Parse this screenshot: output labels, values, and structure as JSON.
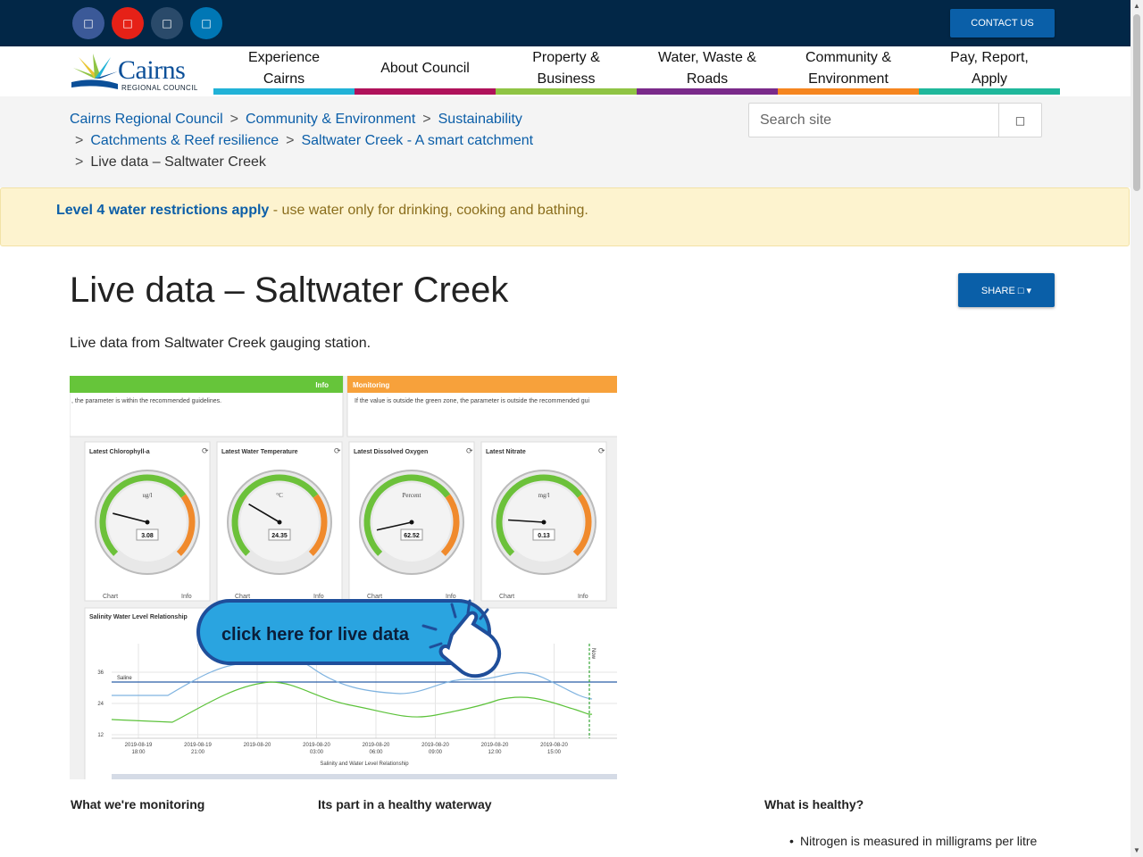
{
  "header": {
    "social": [
      {
        "name": "facebook-icon",
        "glyph": "□",
        "color": "#3b5998"
      },
      {
        "name": "youtube-icon",
        "glyph": "□",
        "color": "#e62117"
      },
      {
        "name": "instagram-icon",
        "glyph": "□",
        "color": "#2a4a6a"
      },
      {
        "name": "linkedin-icon",
        "glyph": "□",
        "color": "#0077b5"
      }
    ],
    "contact_label": "CONTACT US"
  },
  "logo": {
    "word": "Cairns",
    "sub": "REGIONAL COUNCIL"
  },
  "nav": [
    {
      "label": "Experience Cairns",
      "color": "#21b2d7"
    },
    {
      "label": "About Council",
      "color": "#b0125b"
    },
    {
      "label": "Property & Business",
      "color": "#8fc444"
    },
    {
      "label": "Water, Waste & Roads",
      "color": "#7a2a8a"
    },
    {
      "label": "Community & Environment",
      "color": "#f5851f"
    },
    {
      "label": "Pay, Report, Apply",
      "color": "#1fb79b"
    }
  ],
  "breadcrumb": {
    "items": [
      "Cairns Regional Council",
      "Community & Environment",
      "Sustainability",
      "Catchments & Reef resilience",
      "Saltwater Creek - A smart catchment"
    ],
    "current": "Live data – Saltwater Creek"
  },
  "search": {
    "placeholder": "Search site",
    "button_glyph": "□"
  },
  "alert": {
    "link": "Level 4 water restrictions apply",
    "text": " - use water only for drinking, cooking and bathing."
  },
  "page": {
    "title": "Live data – Saltwater Creek",
    "share_label": "SHARE □ ▾",
    "intro": "Live data from Saltwater Creek gauging station."
  },
  "dashboard": {
    "info_label": "Info",
    "info_text": ", the parameter is within the recommended guidelines.",
    "monitoring_label": "Monitoring",
    "monitoring_text": "If the value is outside the green zone, the parameter is outside the recommended gui",
    "gauges": [
      {
        "title": "Latest Chlorophyll-a",
        "unit": "ug/l",
        "value": "3.08",
        "needle": 0.22
      },
      {
        "title": "Latest Water Temperature",
        "unit": "°C",
        "value": "24.35",
        "needle": 0.28
      },
      {
        "title": "Latest Dissolved Oxygen",
        "unit": "Percent",
        "value": "62.52",
        "needle": 0.12
      },
      {
        "title": "Latest Nitrate",
        "unit": "mg/l",
        "value": "0.13",
        "needle": 0.18
      }
    ],
    "chart_link": "Chart",
    "info_link": "Info",
    "salinity_title": "Salinity Water Level Relationship",
    "cta": "click here for live data",
    "saline_label": "Saline",
    "now_label": "Now",
    "y_ticks": [
      "36",
      "24",
      "12"
    ],
    "x_ticks": [
      [
        "2019-08-19",
        "18:00"
      ],
      [
        "2019-08-19",
        "21:00"
      ],
      [
        "2019-08-20",
        ""
      ],
      [
        "2019-08-20",
        "03:00"
      ],
      [
        "2019-08-20",
        "06:00"
      ],
      [
        "2019-08-20",
        "09:00"
      ],
      [
        "2019-08-20",
        "12:00"
      ],
      [
        "2019-08-20",
        "15:00"
      ]
    ],
    "x_caption": "Salinity and Water Level Relationship"
  },
  "columns": {
    "col1": "What we're monitoring",
    "col2": "Its part in a healthy waterway",
    "col3": "What is healthy?",
    "bullet": "Nitrogen is measured in milligrams per litre"
  }
}
